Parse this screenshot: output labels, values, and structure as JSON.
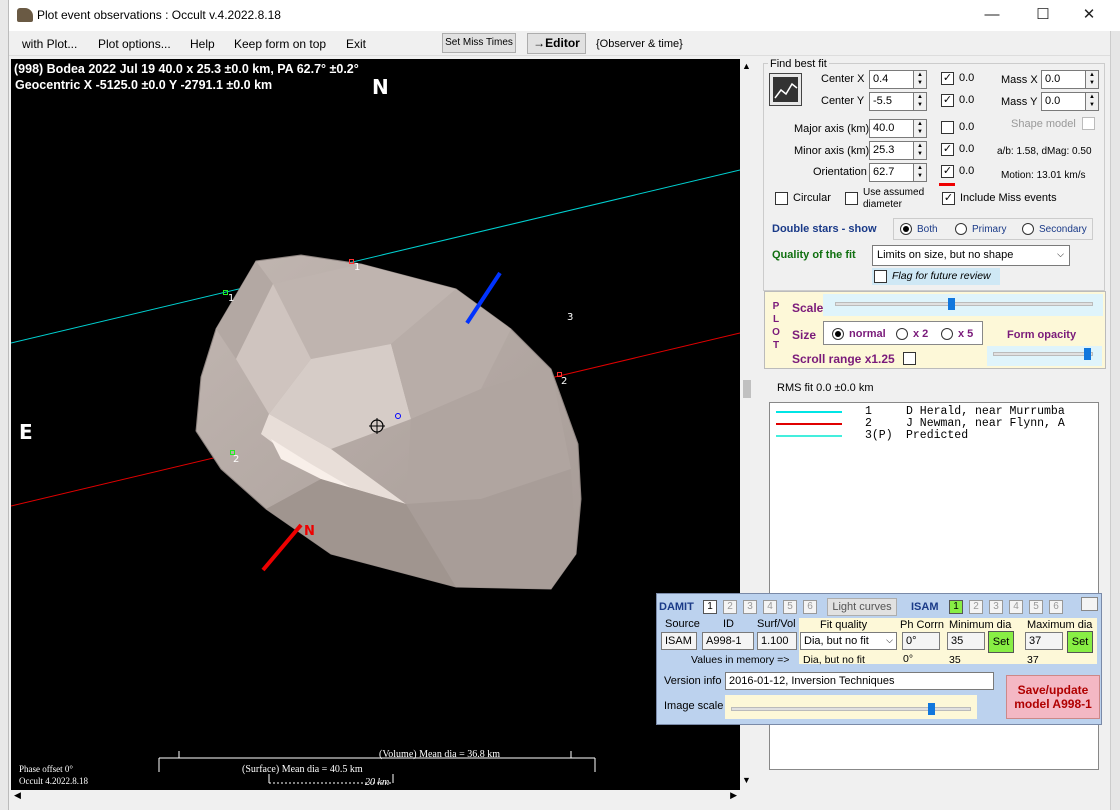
{
  "window": {
    "title": "Plot event observations : Occult v.4.2022.8.18",
    "minimize": "—",
    "maximize": "☐",
    "close": "✕"
  },
  "menu": {
    "with_plot": "with Plot...",
    "plot_options": "Plot options...",
    "help": "Help",
    "keep_on_top": "Keep form on top",
    "exit": "Exit",
    "set_miss_times": "Set Miss Times",
    "editor": "→Editor",
    "observer_time": "{Observer & time}"
  },
  "plot": {
    "header1": "(998) Bodea  2022 Jul 19  40.0 x 25.3 ±0.0 km, PA 62.7° ±0.2°",
    "header2": "Geocentric  X  -5125.0 ±0.0  Y -2791.1 ±0.0 km",
    "north": "N",
    "east": "E",
    "pole_n": "N",
    "chord_labels": [
      "1",
      "1",
      "2",
      "2",
      "3"
    ],
    "phase_offset": "Phase offset 0°",
    "version": "Occult 4.2022.8.18",
    "volume_dia": "(Volume) Mean dia = 36.8 km",
    "surface_dia": "(Surface) Mean dia = 40.5 km",
    "scale_km": "20 km"
  },
  "fit": {
    "group_title": "Find best fit",
    "center_x_label": "Center X",
    "center_x": "0.4",
    "center_x_check": true,
    "center_x_offset": "0.0",
    "center_y_label": "Center Y",
    "center_y": "-5.5",
    "center_y_check": true,
    "center_y_offset": "0.0",
    "mass_x_label": "Mass X",
    "mass_x": "0.0",
    "mass_y_label": "Mass Y",
    "mass_y": "0.0",
    "major_label": "Major axis (km)",
    "major": "40.0",
    "major_check": false,
    "major_offset": "0.0",
    "minor_label": "Minor axis (km)",
    "minor": "25.3",
    "minor_check": true,
    "minor_offset": "0.0",
    "orient_label": "Orientation",
    "orient": "62.7",
    "orient_check": true,
    "orient_offset": "0.0",
    "shape_model_label": "Shape model",
    "ab_text": "a/b: 1.58, dMag: 0.50",
    "motion_text": "Motion: 13.01 km/s",
    "circular_label": "Circular",
    "use_assumed_label": "Use assumed diameter",
    "include_miss_label": "Include Miss events",
    "double_stars_label": "Double stars - show",
    "both": "Both",
    "primary": "Primary",
    "secondary": "Secondary",
    "quality_label": "Quality of the fit",
    "quality_value": "Limits on size, but no shape",
    "flag_review": "Flag for future review"
  },
  "plotbox": {
    "side_label": "P L O T",
    "scale_label": "Scale",
    "scale_level": 0.45,
    "size_label": "Size",
    "normal": "normal",
    "x2": "x 2",
    "x5": "x 5",
    "form_opacity": "Form opacity",
    "opacity_level": 0.97,
    "scroll_range": "Scroll range x1.25"
  },
  "rms": "RMS fit 0.0 ±0.0 km",
  "legend": [
    {
      "num": "1",
      "name": "D Herald, near Murrumba",
      "color": "#00e5e5"
    },
    {
      "num": "2",
      "name": "J Newman, near Flynn, A",
      "color": "#e00000"
    },
    {
      "num": "3(P)",
      "name": "Predicted",
      "color": "#44eedd"
    }
  ],
  "damit": {
    "damit_label": "DAMIT",
    "damit_tabs": [
      "1",
      "2",
      "3",
      "4",
      "5",
      "6"
    ],
    "light_curves": "Light curves",
    "isam_label": "ISAM",
    "isam_tabs": [
      "1",
      "2",
      "3",
      "4",
      "5",
      "6"
    ],
    "source_h": "Source",
    "id_h": "ID",
    "surf_vol_h": "Surf/Vol",
    "fit_quality_h": "Fit quality",
    "ph_corr_h": "Ph Corrn",
    "min_dia_h": "Minimum dia",
    "max_dia_h": "Maximum dia",
    "source": "ISAM",
    "id": "A998-1",
    "surf_vol": "1.100",
    "fit_quality": "Dia, but no fit",
    "ph_corr": "0°",
    "min_dia": "35",
    "max_dia": "37",
    "set": "Set",
    "values_in_memory": "Values in memory =>",
    "mem_fit": "Dia, but no fit",
    "mem_ph": "0°",
    "mem_min": "35",
    "mem_max": "37",
    "version_label": "Version info",
    "version": "2016-01-12, Inversion Techniques",
    "image_scale_label": "Image scale",
    "image_scale_level": 0.85,
    "save_update": "Save/update model A998-1"
  }
}
